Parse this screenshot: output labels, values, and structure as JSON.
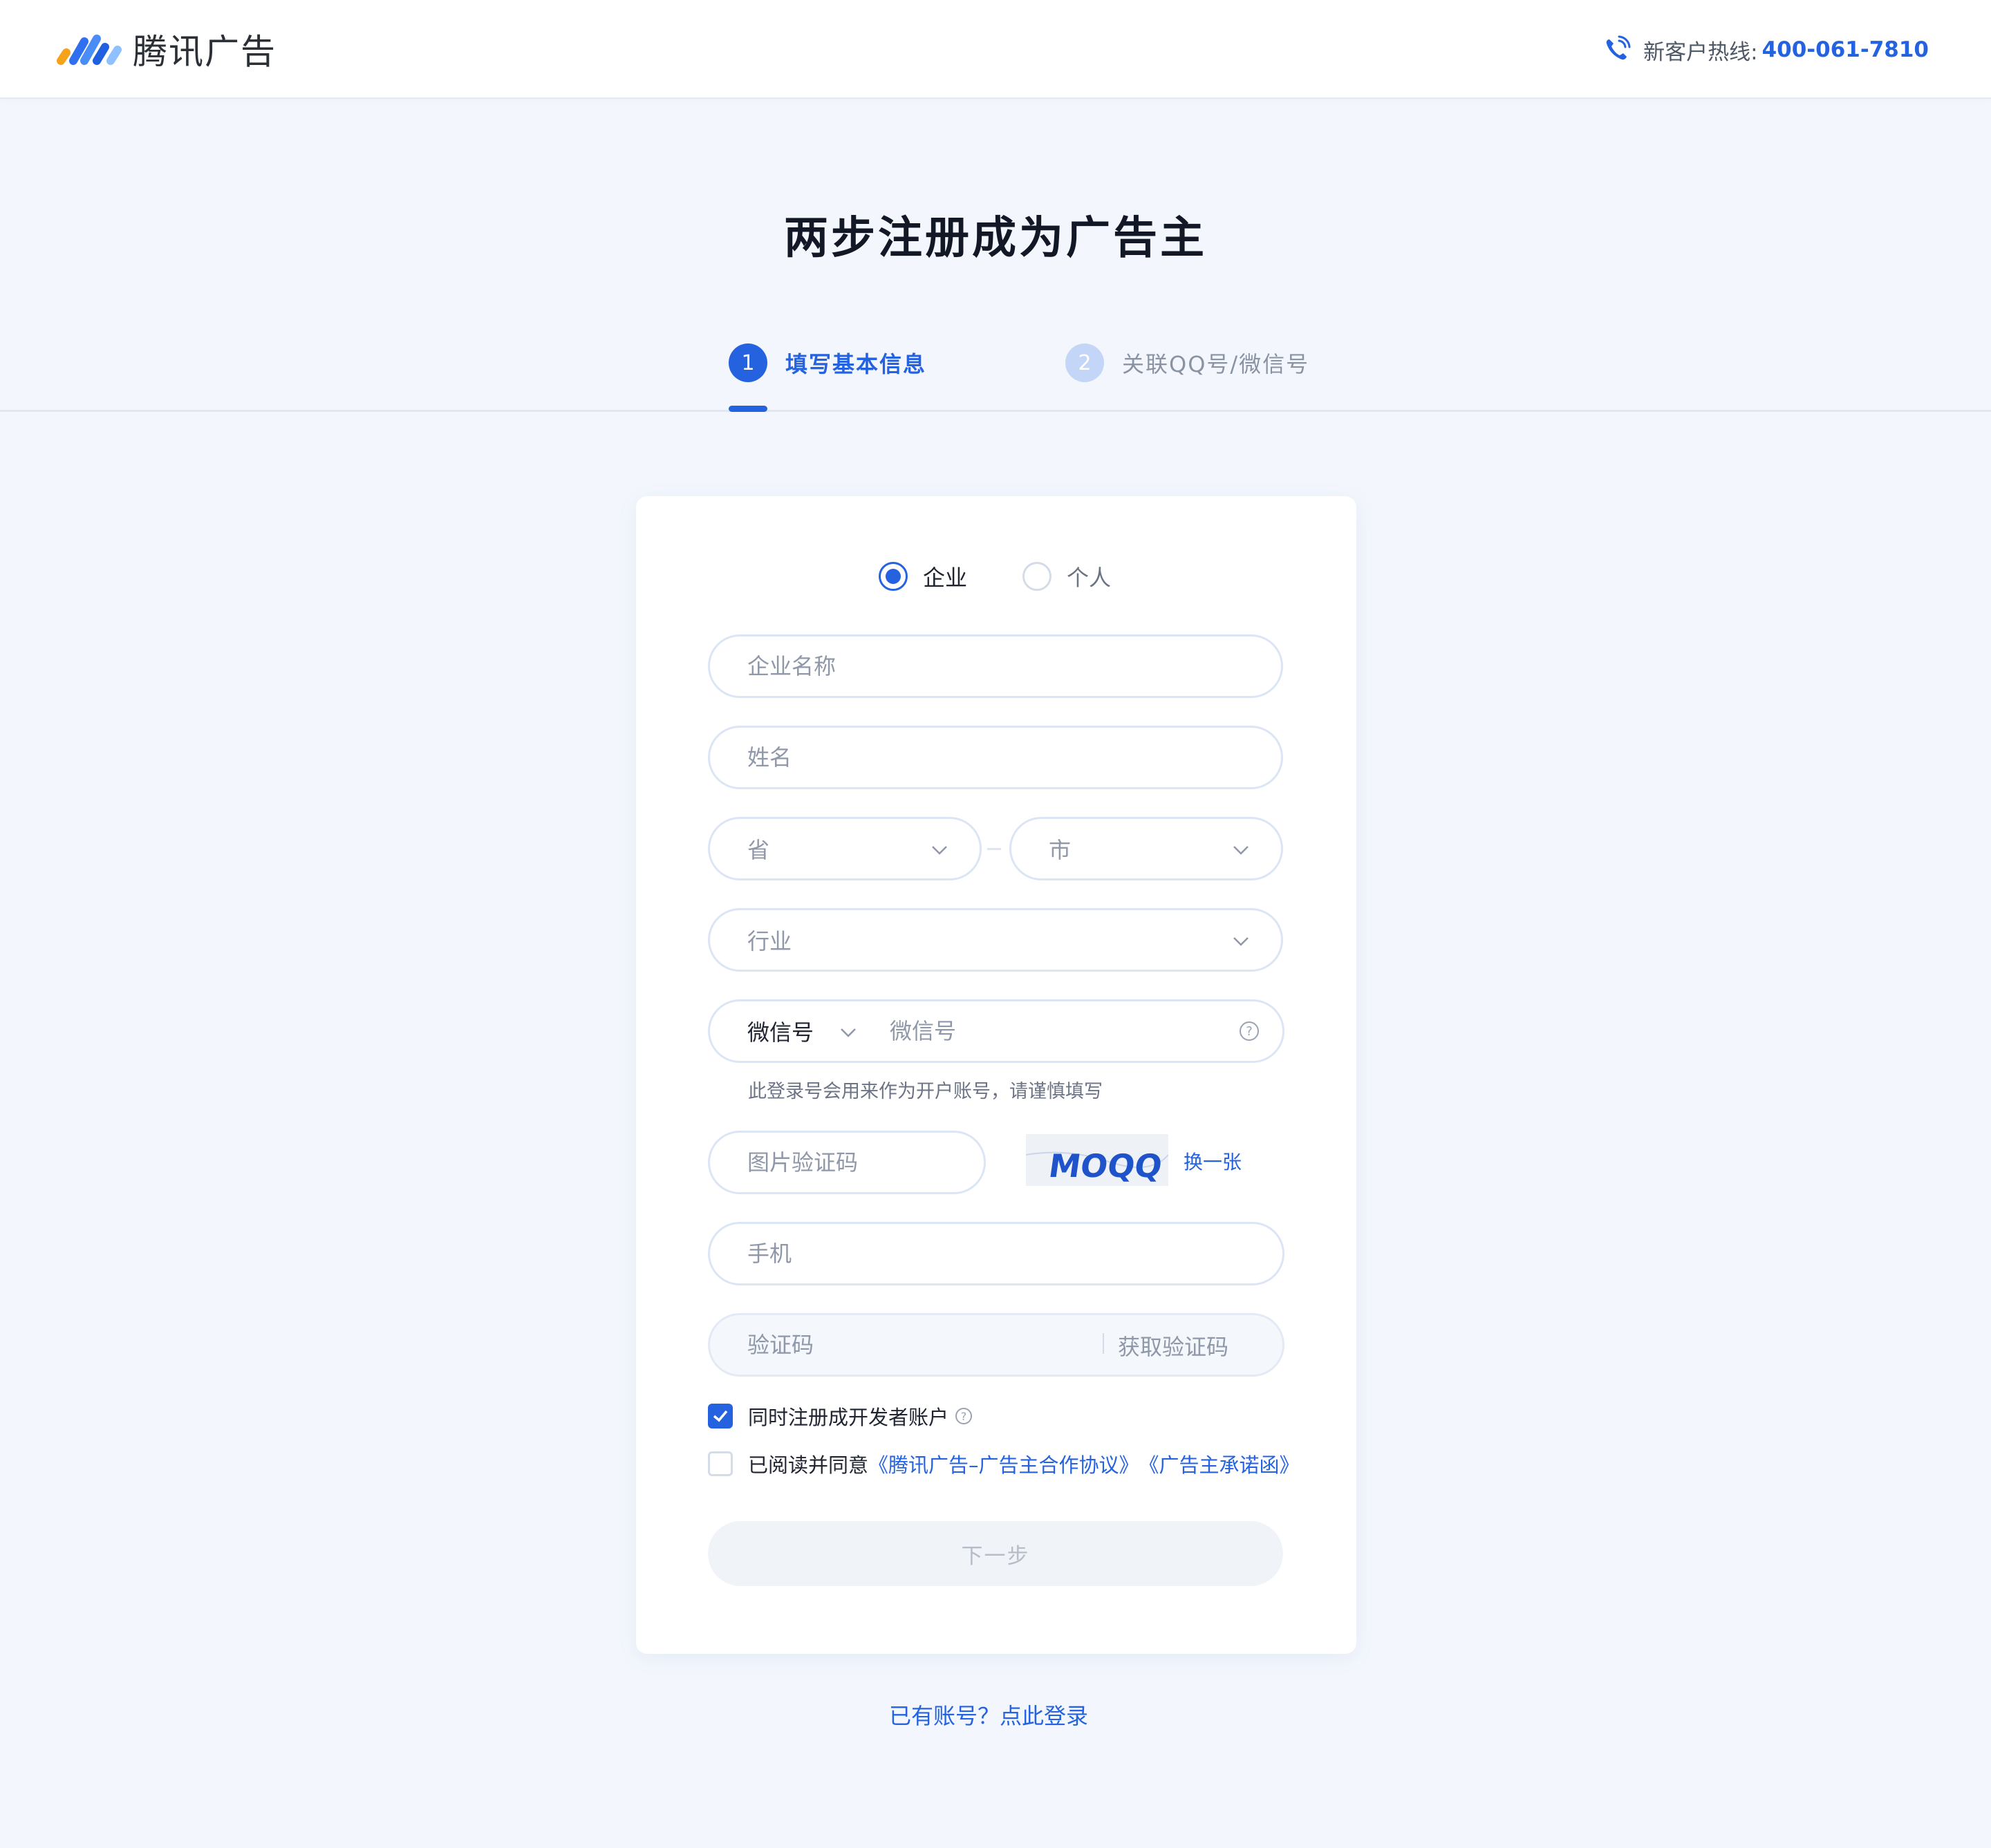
{
  "header": {
    "brand": "腾讯广告",
    "hotline_label": "新客户热线:",
    "hotline_number": "400-061-7810"
  },
  "page": {
    "title": "两步注册成为广告主"
  },
  "steps": [
    {
      "num": "1",
      "label": "填写基本信息",
      "state": "active"
    },
    {
      "num": "2",
      "label": "关联QQ号/微信号",
      "state": "inactive"
    }
  ],
  "form": {
    "account_type": {
      "options": [
        "企业",
        "个人"
      ],
      "selected": "企业"
    },
    "company_name_placeholder": "企业名称",
    "name_placeholder": "姓名",
    "province_placeholder": "省",
    "city_placeholder": "市",
    "industry_placeholder": "行业",
    "wechat_type": "微信号",
    "wechat_placeholder": "微信号",
    "wechat_hint": "此登录号会用来作为开户账号，请谨慎填写",
    "captcha_placeholder": "图片验证码",
    "captcha_text": "MOQQ",
    "captcha_refresh": "换一张",
    "phone_placeholder": "手机",
    "code_placeholder": "验证码",
    "get_code": "获取验证码",
    "dev_account_label": "同时注册成开发者账户",
    "dev_account_checked": true,
    "agree_prefix": "已阅读并同意",
    "agree_link1": "《腾讯广告–广告主合作协议》",
    "agree_link2": "《广告主承诺函》",
    "agree_checked": false,
    "next_button": "下一步"
  },
  "login_link": "已有账号？点此登录",
  "colors": {
    "accent": "#2462e0",
    "page_bg": "#f3f7fd",
    "step_inactive": "#c4d6f7"
  }
}
